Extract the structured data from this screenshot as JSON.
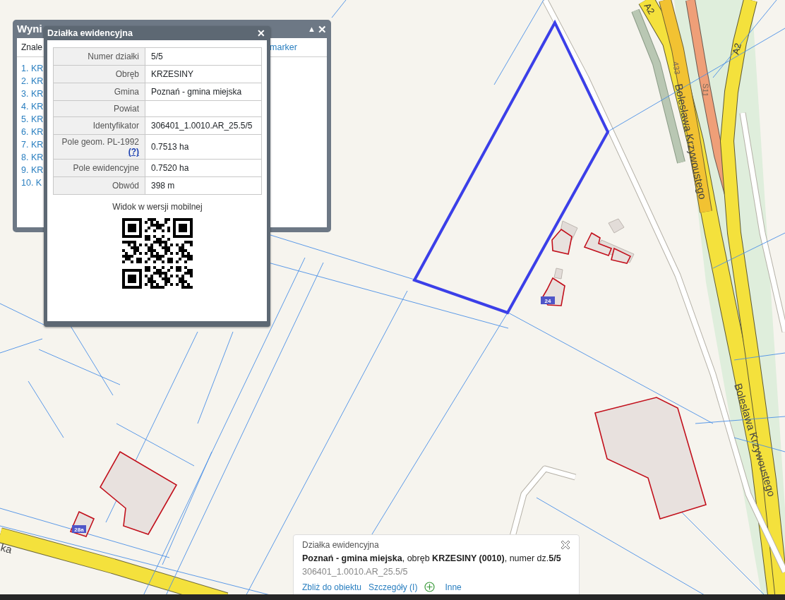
{
  "map": {
    "labels": [
      {
        "kind": "road",
        "text": "A2"
      },
      {
        "kind": "road",
        "text": "A2"
      },
      {
        "kind": "road_number",
        "text": "433"
      },
      {
        "kind": "road_number",
        "text": "S11"
      },
      {
        "kind": "street",
        "text": "Bolesława Krzywoustego"
      },
      {
        "kind": "street",
        "text": "Bolesława Krzywoustego"
      },
      {
        "kind": "street",
        "text": "ka"
      },
      {
        "kind": "house",
        "text": "24"
      },
      {
        "kind": "house",
        "text": "28a"
      }
    ]
  },
  "results_window": {
    "title": "Wyni",
    "collapse": "▲",
    "close": "✕",
    "header_left": "Znale",
    "header_right": "marker",
    "items": [
      "1. KR",
      "2. KR",
      "3. KR",
      "4. KR",
      "5. KR",
      "6. KR",
      "7. KR",
      "8. KR",
      "9. KR",
      "10. K"
    ]
  },
  "parcel_popup": {
    "title": "Działka ewidencyjna",
    "close": "✕",
    "rows": [
      {
        "label": "Numer działki",
        "value": "5/5"
      },
      {
        "label": "Obręb",
        "value": "KRZESINY"
      },
      {
        "label": "Gmina",
        "value": "Poznań - gmina miejska"
      },
      {
        "label": "Powiat"
      },
      {
        "label": "Identyfikator",
        "value": "306401_1.0010.AR_25.5/5"
      },
      {
        "label": "Pole geom. PL-1992",
        "help": "(?)",
        "value": "0.7513 ha"
      },
      {
        "label": "Pole ewidencyjne",
        "value": "0.7520 ha"
      },
      {
        "label": "Obwód",
        "value": "398 m"
      }
    ],
    "mobile_caption": "Widok w wersji mobilnej"
  },
  "info_box": {
    "title": "Działka ewidencyjna",
    "summary": "**Poznań - gmina miejska**, obręb **KRZESINY (0010)**, numer dz.**5/5**",
    "identifier": "306401_1.0010.AR_25.5/5",
    "actions": [
      {
        "kind": "link",
        "text": "Zbliż do obiektu"
      },
      {
        "kind": "link",
        "text": "Szczegóły (I)"
      },
      {
        "kind": "add_icon"
      },
      {
        "kind": "link",
        "text": "Inne"
      }
    ]
  }
}
